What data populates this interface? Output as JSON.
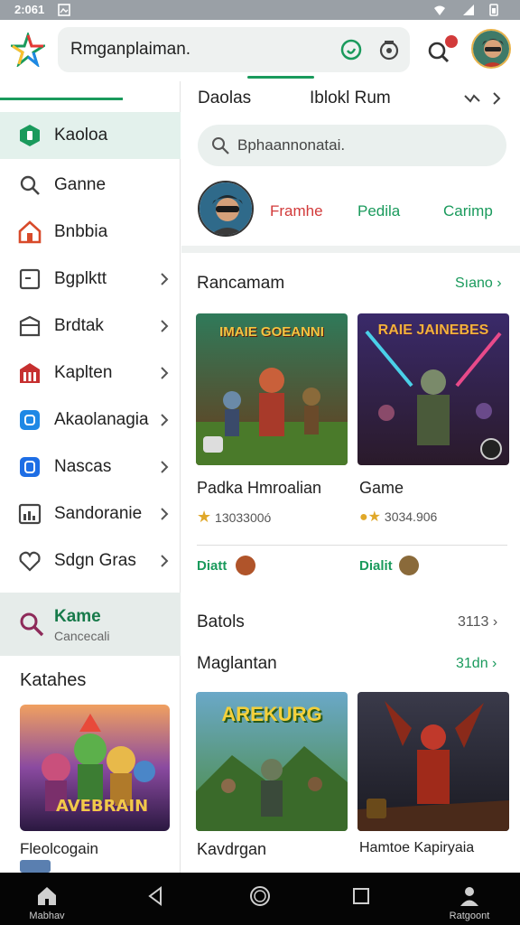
{
  "status_bar": {
    "time": "2:061"
  },
  "top_bar": {
    "search_text": "Rmganplaiman.",
    "notification_count": "0"
  },
  "sidebar": {
    "items": [
      {
        "label": "Kaoloa",
        "icon": "shield-icon",
        "color": "#1a9a5c",
        "active": true
      },
      {
        "label": "Ganne",
        "icon": "search-icon",
        "color": "#444444"
      },
      {
        "label": "Bnbbia",
        "icon": "home-icon",
        "color": "#d84a2a"
      },
      {
        "label": "Bgplktt",
        "icon": "window-icon",
        "color": "#444444"
      },
      {
        "label": "Brdtak",
        "icon": "archive-icon",
        "color": "#444444"
      },
      {
        "label": "Kaplten",
        "icon": "store-icon",
        "color": "#c62f2f"
      },
      {
        "label": "Akaolanagia",
        "icon": "square-icon",
        "color": "#1e88e5"
      },
      {
        "label": "Nascas",
        "icon": "square-icon",
        "color": "#1e6ee5"
      },
      {
        "label": "Sandoranie",
        "icon": "chart-icon",
        "color": "#444444"
      },
      {
        "label": "Sdgn Gras",
        "icon": "heart-icon",
        "color": "#444444"
      }
    ],
    "game_item": {
      "title": "Kame",
      "subtitle": "Cancecali"
    },
    "heading": "Katahes",
    "card_art_text": "AVEBRAIN",
    "card_title": "Fleolcogain"
  },
  "main": {
    "header_left": "Daolas",
    "header_mid": "Iblokl Rum",
    "search_placeholder": "Bphaannonatai.",
    "pills": [
      "Framhe",
      "Pedila",
      "Carimp"
    ],
    "section1": {
      "title": "Rancamam",
      "link": "Sıano",
      "cards": [
        {
          "art_text": "IMAIE GOEANNI",
          "name": "Padka Hmroalian",
          "meta": "1303300ó"
        },
        {
          "art_text": "RAIE JAINEBES",
          "name": "Game",
          "meta": "3034.906"
        }
      ],
      "download_label": "Diatt",
      "download_label_2": "Dialit"
    },
    "section2": {
      "title": "Batols",
      "value": "3113"
    },
    "section3": {
      "title": "Maglantan",
      "link": "31dn",
      "cards": [
        {
          "art_text": "AREKURG",
          "name": "Kavdrgan"
        },
        {
          "art_text": "",
          "name": "Hamtoe Kapiryaia"
        }
      ]
    }
  },
  "nav_bar": {
    "home_label": "Mabhav",
    "profile_label": "Ratgoont"
  },
  "colors": {
    "accent": "#1a9a5c",
    "red": "#d23a3a"
  }
}
